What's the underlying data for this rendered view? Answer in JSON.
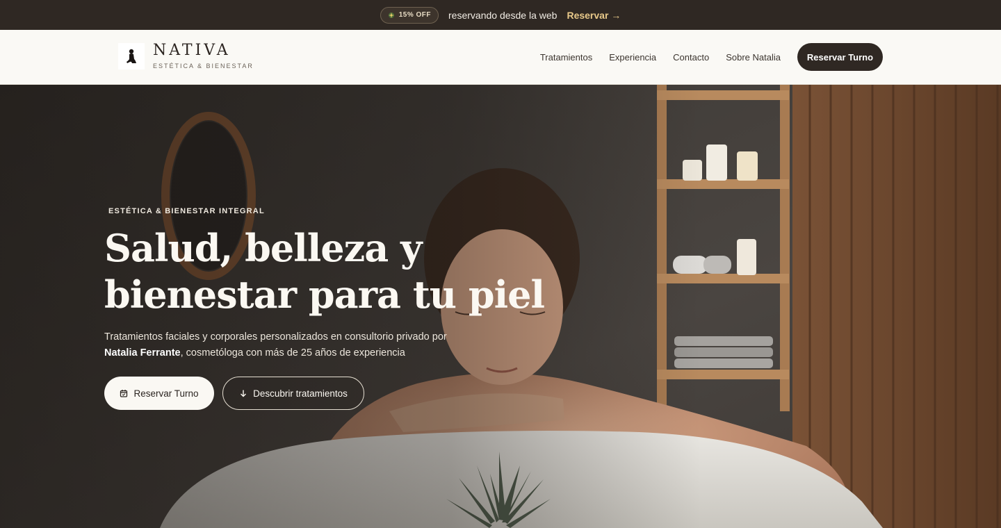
{
  "promo": {
    "badge": "15% OFF",
    "text": "reservando desde la web",
    "link": "Reservar →"
  },
  "nav": {
    "brand": "NATIVA",
    "brand_sub": "ESTÉTICA & BIENESTAR",
    "links": [
      "Tratamientos",
      "Experiencia",
      "Contacto",
      "Sobre Natalia"
    ],
    "cta": "Reservar Turno"
  },
  "hero": {
    "eyebrow": "ESTÉTICA & BIENESTAR INTEGRAL",
    "headline": "Salud, belleza y bienestar para tu piel",
    "lede_before": "Tratamientos faciales y corporales personalizados en consultorio privado por",
    "lede_name": "Natalia Ferrante",
    "lede_after": ", cosmetóloga con más de 25 años de experiencia",
    "primary_button": "Reservar Turno",
    "secondary_button": "Descubrir tratamientos"
  },
  "colors": {
    "dark": "#2f2823",
    "cream": "#faf9f5",
    "gold": "#e8c98a"
  },
  "icons": [
    "sparkle-icon",
    "logo-figure-icon",
    "calendar-icon",
    "arrow-down-icon"
  ]
}
